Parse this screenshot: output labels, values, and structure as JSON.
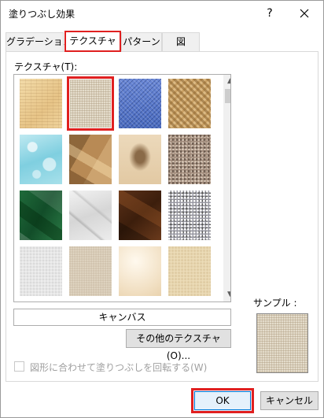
{
  "dialog": {
    "title": "塗りつぶし効果",
    "help_glyph": "?"
  },
  "tabs": [
    {
      "label": "グラデーション",
      "active": false
    },
    {
      "label": "テクスチャ",
      "active": true
    },
    {
      "label": "パターン",
      "active": false
    },
    {
      "label": "図",
      "active": false
    }
  ],
  "texture_panel": {
    "label": "テクスチャ(T):",
    "selected_index": 1,
    "textures": [
      {
        "icon": "papyrus-texture"
      },
      {
        "icon": "canvas-texture"
      },
      {
        "icon": "denim-texture"
      },
      {
        "icon": "woven-mat-texture"
      },
      {
        "icon": "water-droplets-texture"
      },
      {
        "icon": "crumpled-paper-texture"
      },
      {
        "icon": "fossil-texture"
      },
      {
        "icon": "granite-texture"
      },
      {
        "icon": "green-marble-texture"
      },
      {
        "icon": "white-marble-texture"
      },
      {
        "icon": "brown-marble-texture"
      },
      {
        "icon": "gravel-texture"
      },
      {
        "icon": "recycled-paper-texture"
      },
      {
        "icon": "stucco-texture"
      },
      {
        "icon": "parchment-texture"
      },
      {
        "icon": "sand-texture"
      }
    ],
    "selected_name": "キャンバス",
    "more_button": "その他のテクスチャ(O)...",
    "rotate_checkbox": {
      "label": "図形に合わせて塗りつぶしを回転する(W)",
      "checked": false,
      "enabled": false
    }
  },
  "sample": {
    "label": "サンプル :"
  },
  "buttons": {
    "ok": "OK",
    "cancel": "キャンセル"
  },
  "colors": {
    "highlight_red": "#e02020",
    "focus_blue": "#0078d7"
  }
}
